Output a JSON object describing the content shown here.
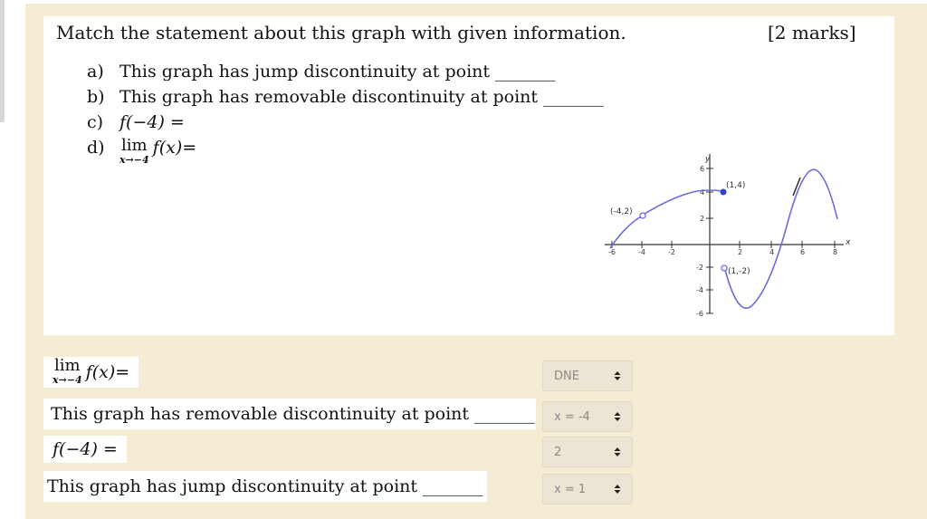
{
  "question": {
    "title": "Match the statement about this graph with given information.",
    "marks": "[2 marks]",
    "items": [
      {
        "letter": "a)",
        "text": "This graph has jump discontinuity at point _______"
      },
      {
        "letter": "b)",
        "text": "This graph has removable discontinuity at point _______"
      },
      {
        "letter": "c)",
        "text": "f(−4) ="
      },
      {
        "letter": "d)",
        "lim": "lim",
        "sub": "x→−4",
        "text": "f(x)="
      }
    ]
  },
  "graph": {
    "y_axis_label": "y",
    "x_axis_label": "x",
    "x_ticks": [
      "-6",
      "-4",
      "-2",
      "2",
      "4",
      "6",
      "8"
    ],
    "y_ticks": [
      "6",
      "4",
      "2",
      "-2",
      "-4",
      "-6"
    ],
    "point_labels": [
      "(1,4)",
      "(-4,2)",
      "(1,-2)"
    ],
    "curve_color": "#6a6ae0"
  },
  "matching": [
    {
      "prompt_lim": "lim",
      "prompt_sub": "x→−4",
      "prompt": "f(x)=",
      "answer": "DNE"
    },
    {
      "prompt": "This graph has removable discontinuity at point _______",
      "answer": "x = -4"
    },
    {
      "prompt": "f(−4) =",
      "answer": "2"
    },
    {
      "prompt": "This graph has jump discontinuity at point _______",
      "answer": "x = 1"
    }
  ]
}
